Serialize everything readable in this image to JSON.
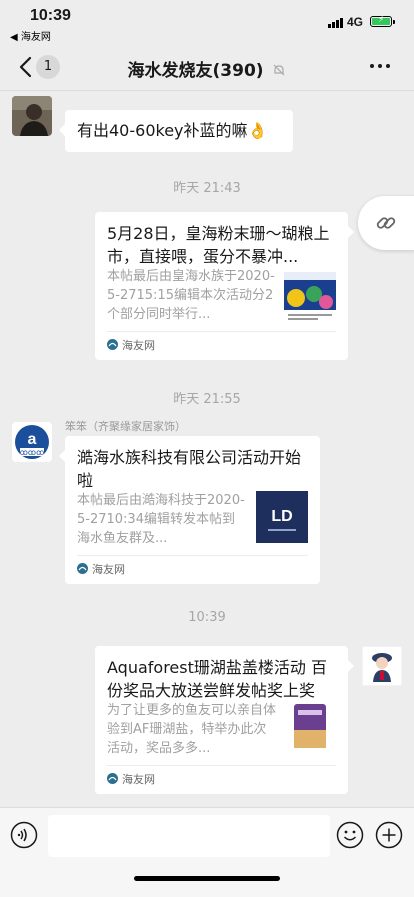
{
  "status_bar": {
    "time": "10:39",
    "back_app": "◀ 海友网",
    "network": "4G"
  },
  "header": {
    "title": "海水发烧友(390)",
    "unread_count": "1",
    "back_icon": "chevron-left-icon",
    "more_icon": "more-icon",
    "mute_icon": "mute-icon"
  },
  "messages": [
    {
      "type": "text",
      "side": "left",
      "text": "有出40-60key补蓝的嘛👌"
    },
    {
      "type": "time",
      "text": "昨天 21:43"
    },
    {
      "type": "card",
      "side": "right",
      "title": "5月28日，皇海粉末珊～瑚粮上市，直接喂，蛋分不暴冲...",
      "desc": "本帖最后由皇海水族于2020-5-2715:15编辑本次活动分2个部分同时举行...",
      "source": "海友网"
    },
    {
      "type": "time",
      "text": "昨天 21:55"
    },
    {
      "type": "card",
      "side": "left",
      "sender": "笨笨（齐聚缘家居家饰）",
      "title": "澔海水族科技有限公司活动开始啦",
      "desc": "本帖最后由澔海科技于2020-5-2710:34编辑转发本帖到海水鱼友群及...",
      "source": "海友网"
    },
    {
      "type": "time",
      "text": "10:39"
    },
    {
      "type": "card",
      "side": "right",
      "title": "Aquaforest珊湖盐盖楼活动 百份奖品大放送尝鲜发帖奖上奖",
      "desc": "为了让更多的鱼友可以亲自体验到AF珊湖盐，特举办此次活动，奖品多多...",
      "source": "海友网"
    }
  ],
  "input_bar": {
    "placeholder": "",
    "voice_icon": "voice-icon",
    "emoji_icon": "emoji-icon",
    "plus_icon": "plus-icon"
  },
  "colors": {
    "background": "#ededed",
    "bubble": "#ffffff",
    "battery": "#34c759"
  }
}
